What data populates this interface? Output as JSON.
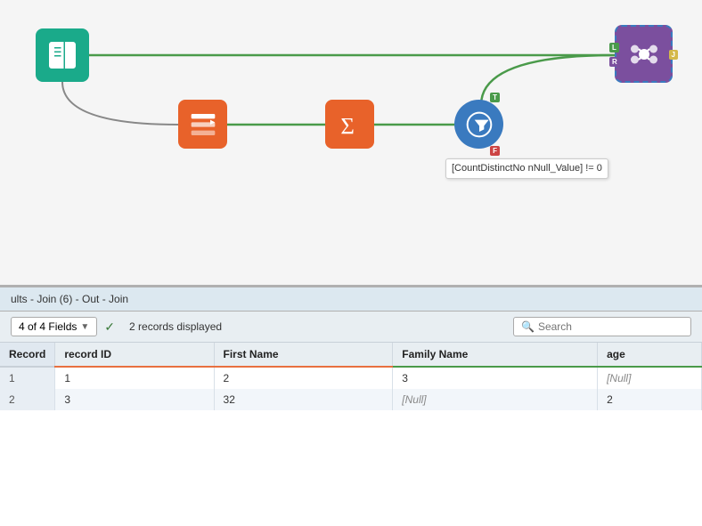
{
  "canvas": {
    "nodes": {
      "book": {
        "label": "Input",
        "icon": "book-icon"
      },
      "select": {
        "label": "Select",
        "icon": "select-icon"
      },
      "summarize": {
        "label": "Summarize",
        "icon": "summarize-icon"
      },
      "filter": {
        "label": "Filter",
        "icon": "filter-icon"
      },
      "join": {
        "label": "Join",
        "icon": "join-icon"
      }
    },
    "filter_condition": "[CountDistinctNo\nnNull_Value] != 0"
  },
  "results": {
    "header": "ults - Join (6) - Out - Join",
    "fields_label": "4 of 4 Fields",
    "records_label": "2 records displayed",
    "search_placeholder": "Search",
    "table": {
      "columns": [
        "Record",
        "record ID",
        "First Name",
        "Family Name",
        "age"
      ],
      "rows": [
        {
          "record": "1",
          "record_id": "1",
          "first_name": "2",
          "family_name": "3",
          "age_null": true,
          "age": "[Null]"
        },
        {
          "record": "2",
          "record_id": "3",
          "first_name": "32",
          "family_name_null": true,
          "family_name": "[Null]",
          "age": "2"
        }
      ]
    }
  }
}
